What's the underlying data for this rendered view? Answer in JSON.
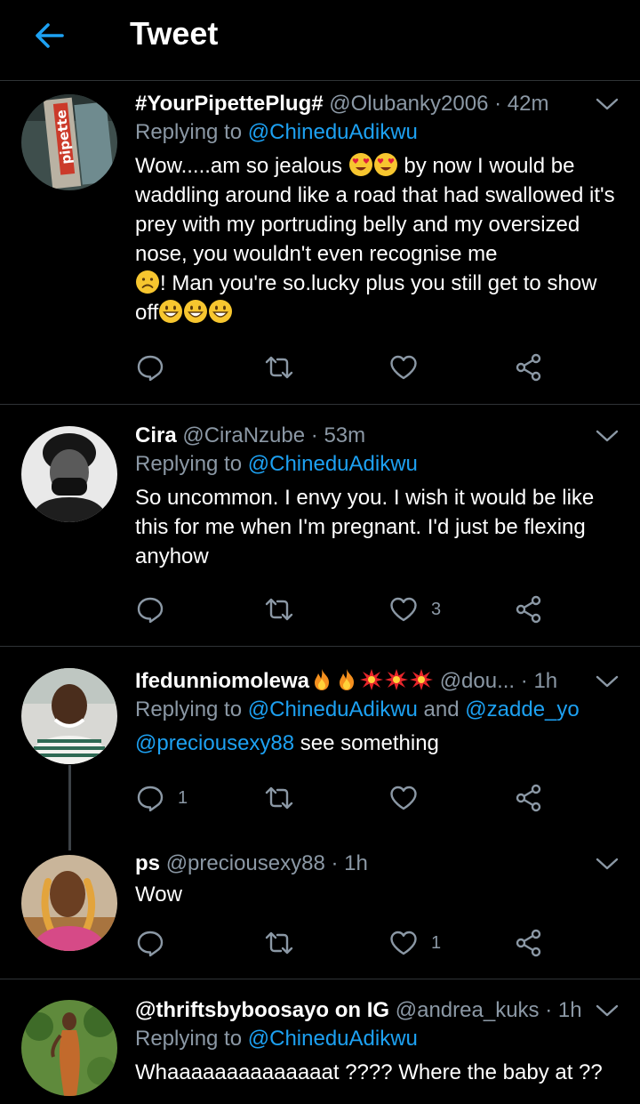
{
  "header": {
    "title": "Tweet"
  },
  "tweets": [
    {
      "name": "#YourPipettePlug#",
      "handle": "@Olubanky2006",
      "dot": "·",
      "time": "42m",
      "reply_prefix": "Replying to ",
      "reply_to": "@ChineduAdikwu",
      "text_part1": "Wow.....am so jealous ",
      "text_part2": " by now I would be waddling around like a road that had swallowed it's prey with my portruding belly and my oversized nose, you wouldn't even recognise me ",
      "text_part3": "! Man you're so.lucky plus you still get to show off",
      "avatar_label": "pipette",
      "reply_count": "",
      "retweet_count": "",
      "like_count": ""
    },
    {
      "name": "Cira",
      "handle": "@CiraNzube",
      "dot": "·",
      "time": "53m",
      "reply_prefix": "Replying to ",
      "reply_to": "@ChineduAdikwu",
      "text": "So uncommon. I envy you. I wish it would be like this for me when I'm pregnant. I'd just be flexing anyhow",
      "reply_count": "",
      "retweet_count": "",
      "like_count": "3"
    },
    {
      "name": "Ifedunniomolewa",
      "handle": "@dou...",
      "dot": "·",
      "time": "1h",
      "reply_prefix": "Replying to ",
      "reply_to": "@ChineduAdikwu",
      "reply_and": " and ",
      "reply_to2": "@zadde_yo",
      "mention": "@preciousexy88",
      "text": " see something",
      "reply_count": "1",
      "retweet_count": "",
      "like_count": ""
    },
    {
      "name": "ps",
      "handle": "@preciousexy88",
      "dot": "·",
      "time": "1h",
      "text": "Wow",
      "reply_count": "",
      "retweet_count": "",
      "like_count": "1"
    },
    {
      "name": "@thriftsbyboosayo on IG",
      "handle": "@andrea_kuks",
      "dot": "·",
      "time": "1h",
      "reply_prefix": "Replying to ",
      "reply_to": "@ChineduAdikwu",
      "text": "Whaaaaaaaaaaaaaat ???? Where the baby at ??"
    }
  ],
  "colors": {
    "background": "#000000",
    "text": "#ffffff",
    "secondary": "#8b98a5",
    "link": "#1da1f2",
    "divider": "#2f3336"
  },
  "icons": {
    "back": "back-arrow-icon",
    "caret": "chevron-down-icon",
    "reply": "reply-icon",
    "retweet": "retweet-icon",
    "like": "heart-icon",
    "share": "share-icon"
  }
}
